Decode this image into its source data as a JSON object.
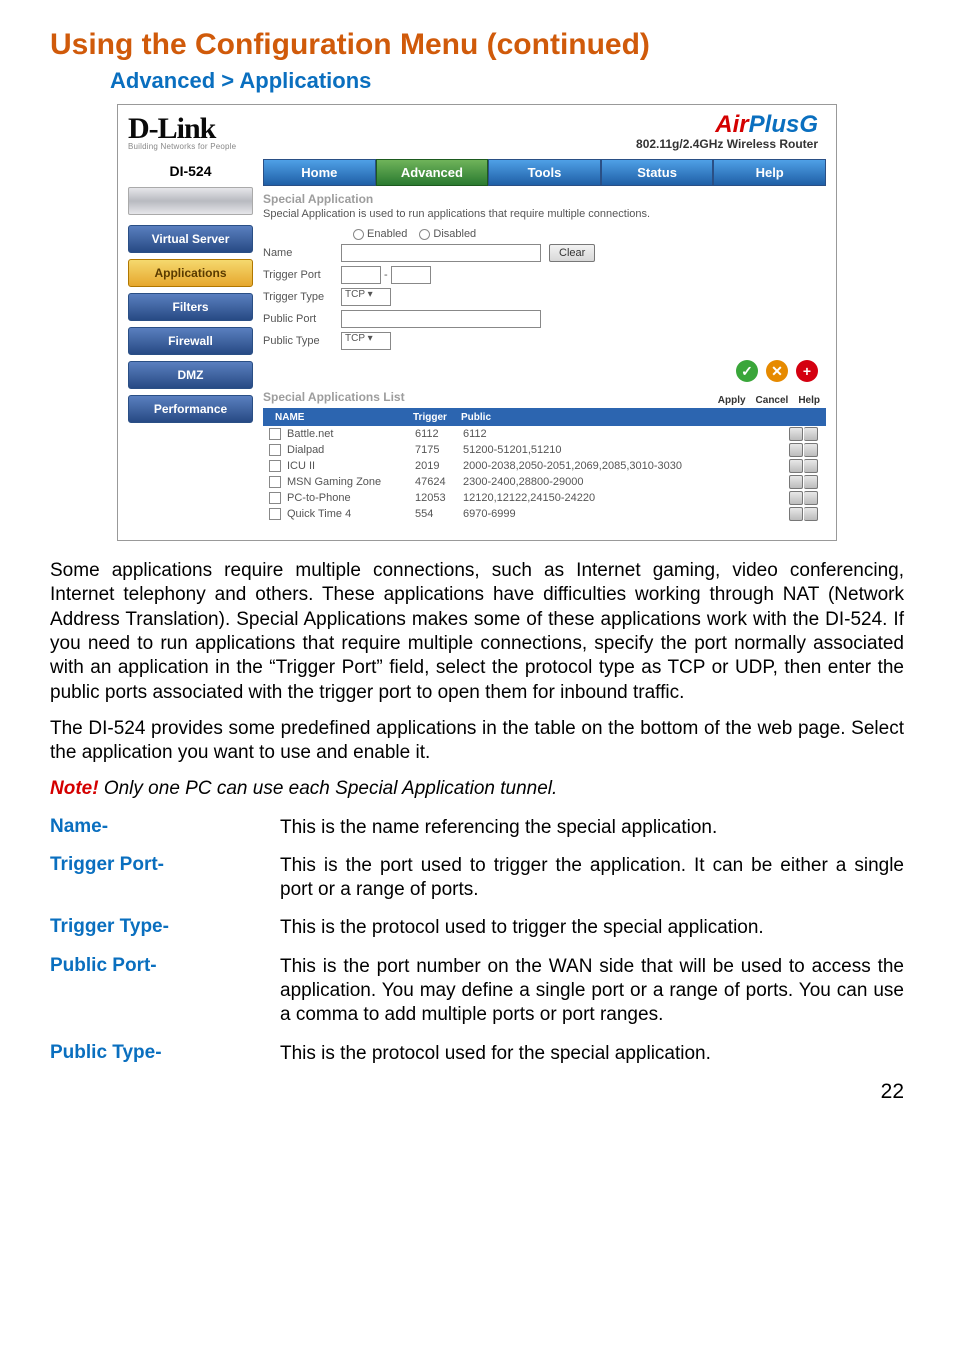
{
  "page_title": "Using the Configuration Menu (continued)",
  "breadcrumb": "Advanced > Applications",
  "page_number": "22",
  "header": {
    "brand": "D-Link",
    "brand_tagline": "Building Networks for People",
    "product_logo_air": "Air",
    "product_logo_plus": "Plus",
    "product_logo_g": "G",
    "product_subhead": "802.11g/2.4GHz Wireless Router"
  },
  "sidebar": {
    "model": "DI-524",
    "items": [
      {
        "label": "Virtual Server",
        "active": false
      },
      {
        "label": "Applications",
        "active": true
      },
      {
        "label": "Filters",
        "active": false
      },
      {
        "label": "Firewall",
        "active": false
      },
      {
        "label": "DMZ",
        "active": false
      },
      {
        "label": "Performance",
        "active": false
      }
    ]
  },
  "tabs": [
    {
      "label": "Home",
      "active": false
    },
    {
      "label": "Advanced",
      "active": true
    },
    {
      "label": "Tools",
      "active": false
    },
    {
      "label": "Status",
      "active": false
    },
    {
      "label": "Help",
      "active": false
    }
  ],
  "form": {
    "section_title": "Special Application",
    "section_desc": "Special Application is used to run applications that require multiple connections.",
    "enabled_label": "Enabled",
    "disabled_label": "Disabled",
    "name_label": "Name",
    "clear_btn": "Clear",
    "trigger_port_label": "Trigger Port",
    "trigger_port_sep": "-",
    "trigger_type_label": "Trigger Type",
    "trigger_type_value": "TCP",
    "public_port_label": "Public Port",
    "public_type_label": "Public Type",
    "public_type_value": "TCP"
  },
  "actions": {
    "apply": "Apply",
    "cancel": "Cancel",
    "help": "Help"
  },
  "list": {
    "title": "Special Applications List",
    "cols": {
      "name": "NAME",
      "trigger": "Trigger",
      "public": "Public"
    },
    "rows": [
      {
        "name": "Battle.net",
        "trigger": "6112",
        "public": "6112"
      },
      {
        "name": "Dialpad",
        "trigger": "7175",
        "public": "51200-51201,51210"
      },
      {
        "name": "ICU II",
        "trigger": "2019",
        "public": "2000-2038,2050-2051,2069,2085,3010-3030"
      },
      {
        "name": "MSN Gaming Zone",
        "trigger": "47624",
        "public": "2300-2400,28800-29000"
      },
      {
        "name": "PC-to-Phone",
        "trigger": "12053",
        "public": "12120,12122,24150-24220"
      },
      {
        "name": "Quick Time 4",
        "trigger": "554",
        "public": "6970-6999"
      }
    ]
  },
  "body": {
    "p1": "Some applications require multiple connections, such as Internet gaming, video conferencing, Internet telephony and others. These applications have difficulties working through NAT (Network Address Translation). Special Applications makes some of these applications work with the DI-524. If you need to run applications that require multiple connections, specify the port normally associated with an application in the “Trigger Port” field, select the protocol type as TCP or UDP, then enter the public ports associated with the trigger port to open them for inbound traffic.",
    "p2": "The DI-524 provides some predefined applications in the table on the bottom of the web page. Select the application you want to use and enable it.",
    "note_label": "Note!",
    "note_rest": " Only one PC can use each Special Application tunnel."
  },
  "defs": [
    {
      "term": "Name-",
      "body": "This is the name referencing the special application."
    },
    {
      "term": "Trigger Port-",
      "body": "This is the port used to trigger the application. It can be either a single port or a range of ports."
    },
    {
      "term": "Trigger Type-",
      "body": "This is the protocol used to trigger the special application."
    },
    {
      "term": "Public Port-",
      "body": "This is the port number on the WAN side that will be used to access the application. You may define a single port or a range of ports. You can use a comma to add multiple ports or port ranges."
    },
    {
      "term": "Public Type-",
      "body": "This is the protocol used for the special application."
    }
  ]
}
